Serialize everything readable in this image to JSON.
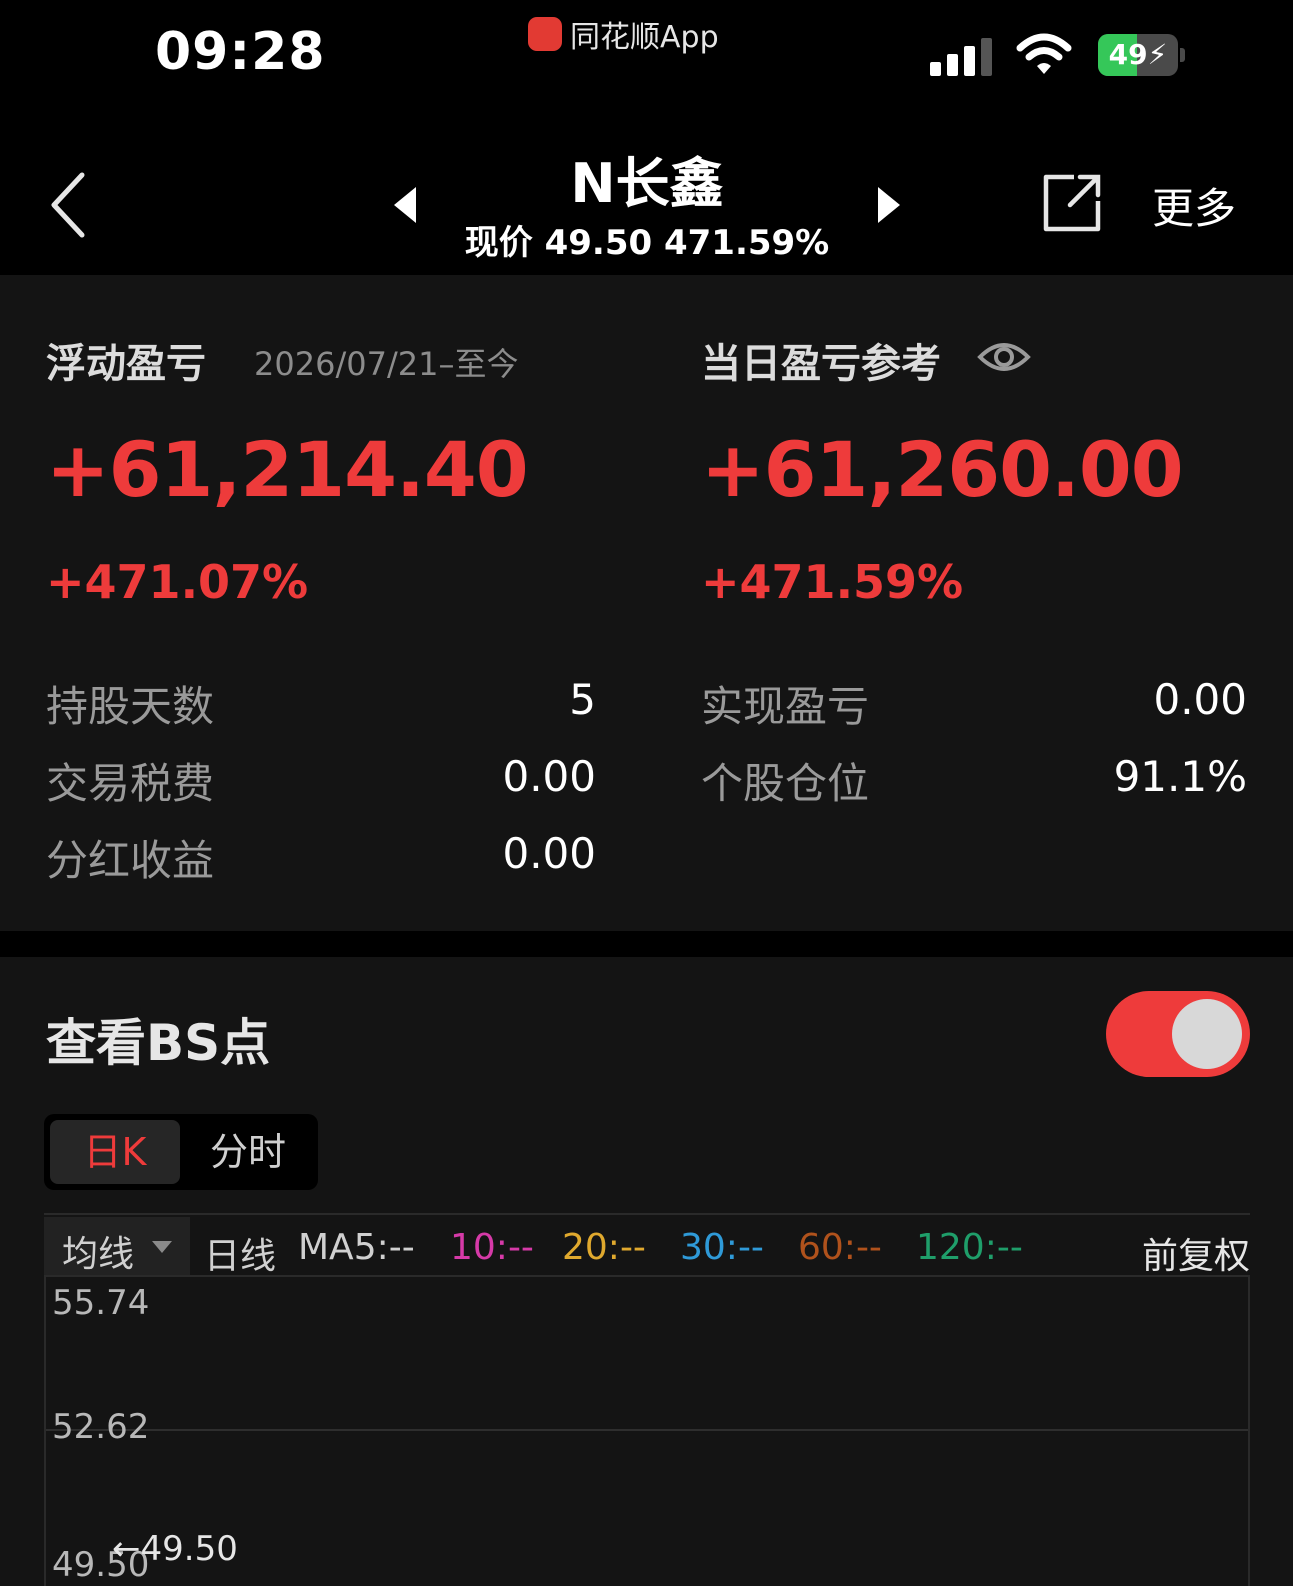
{
  "status_bar": {
    "time": "09:28",
    "source_app": "同花顺App",
    "battery_level": 49,
    "battery_text": "49",
    "battery_charging": true,
    "signal_bars": 3
  },
  "header": {
    "stock_name": "N长鑫",
    "price_line": "现价 49.50 471.59%",
    "more_label": "更多"
  },
  "profit": {
    "floating": {
      "title": "浮动盈亏",
      "date_range": "2026/07/21–至今",
      "amount": "+61,214.40",
      "percent": "+471.07%"
    },
    "daily": {
      "title": "当日盈亏参考",
      "amount": "+61,260.00",
      "percent": "+471.59%"
    },
    "stats_left": [
      {
        "label": "持股天数",
        "value": "5"
      },
      {
        "label": "交易税费",
        "value": "0.00"
      },
      {
        "label": "分红收益",
        "value": "0.00"
      }
    ],
    "stats_right": [
      {
        "label": "实现盈亏",
        "value": "0.00"
      },
      {
        "label": "个股仓位",
        "value": "91.1%"
      }
    ]
  },
  "bs": {
    "title": "查看BS点",
    "toggle_on": true,
    "segments": [
      "日K",
      "分时"
    ],
    "active_segment": "日K"
  },
  "ma_bar": {
    "selector": "均线",
    "period": "日线",
    "ma5": "MA5:--",
    "ma10": "10:--",
    "ma20": "20:--",
    "ma30": "30:--",
    "ma60": "60:--",
    "ma120": "120:--",
    "adjust": "前复权"
  },
  "colors": {
    "up_red": "#ee3b3b",
    "ma5": "#d0d0d0",
    "ma10": "#d63aa8",
    "ma20": "#e0a92e",
    "ma30": "#2f9ad8",
    "ma60": "#b0521c",
    "ma120": "#1f9e6a"
  },
  "chart": {
    "y_labels": [
      "55.74",
      "52.62",
      "49.50"
    ],
    "current_price": "49.50"
  }
}
